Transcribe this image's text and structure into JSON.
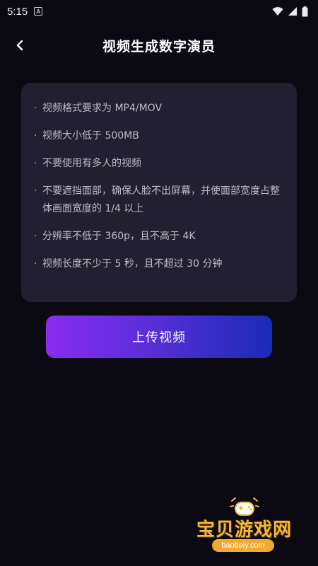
{
  "status_bar": {
    "time": "5:15",
    "notification_icon": "a-icon",
    "icons": [
      "wifi-icon",
      "signal-icon",
      "battery-icon"
    ]
  },
  "header": {
    "title": "视频生成数字演员",
    "back_icon": "chevron-left-icon"
  },
  "requirements": {
    "bullet": "·",
    "items": [
      "视频格式要求为 MP4/MOV",
      "视频大小低于 500MB",
      "不要使用有多人的视频",
      "不要遮挡面部，确保人脸不出屏幕，并使面部宽度占整体画面宽度的 1/4 以上",
      "分辨率不低于 360p，且不高于 4K",
      "视频长度不少于 5 秒，且不超过 30 分钟"
    ]
  },
  "upload_button": {
    "label": "上传视频",
    "gradient": [
      "#8a2cf1",
      "#1b2ab6"
    ]
  },
  "watermark": {
    "name": "宝贝游戏网",
    "url": "baobeiy.com"
  },
  "colors": {
    "background": "#0b0a12",
    "card": "#222030",
    "text_secondary": "#bdbcc6",
    "watermark": "#f4b73a"
  }
}
